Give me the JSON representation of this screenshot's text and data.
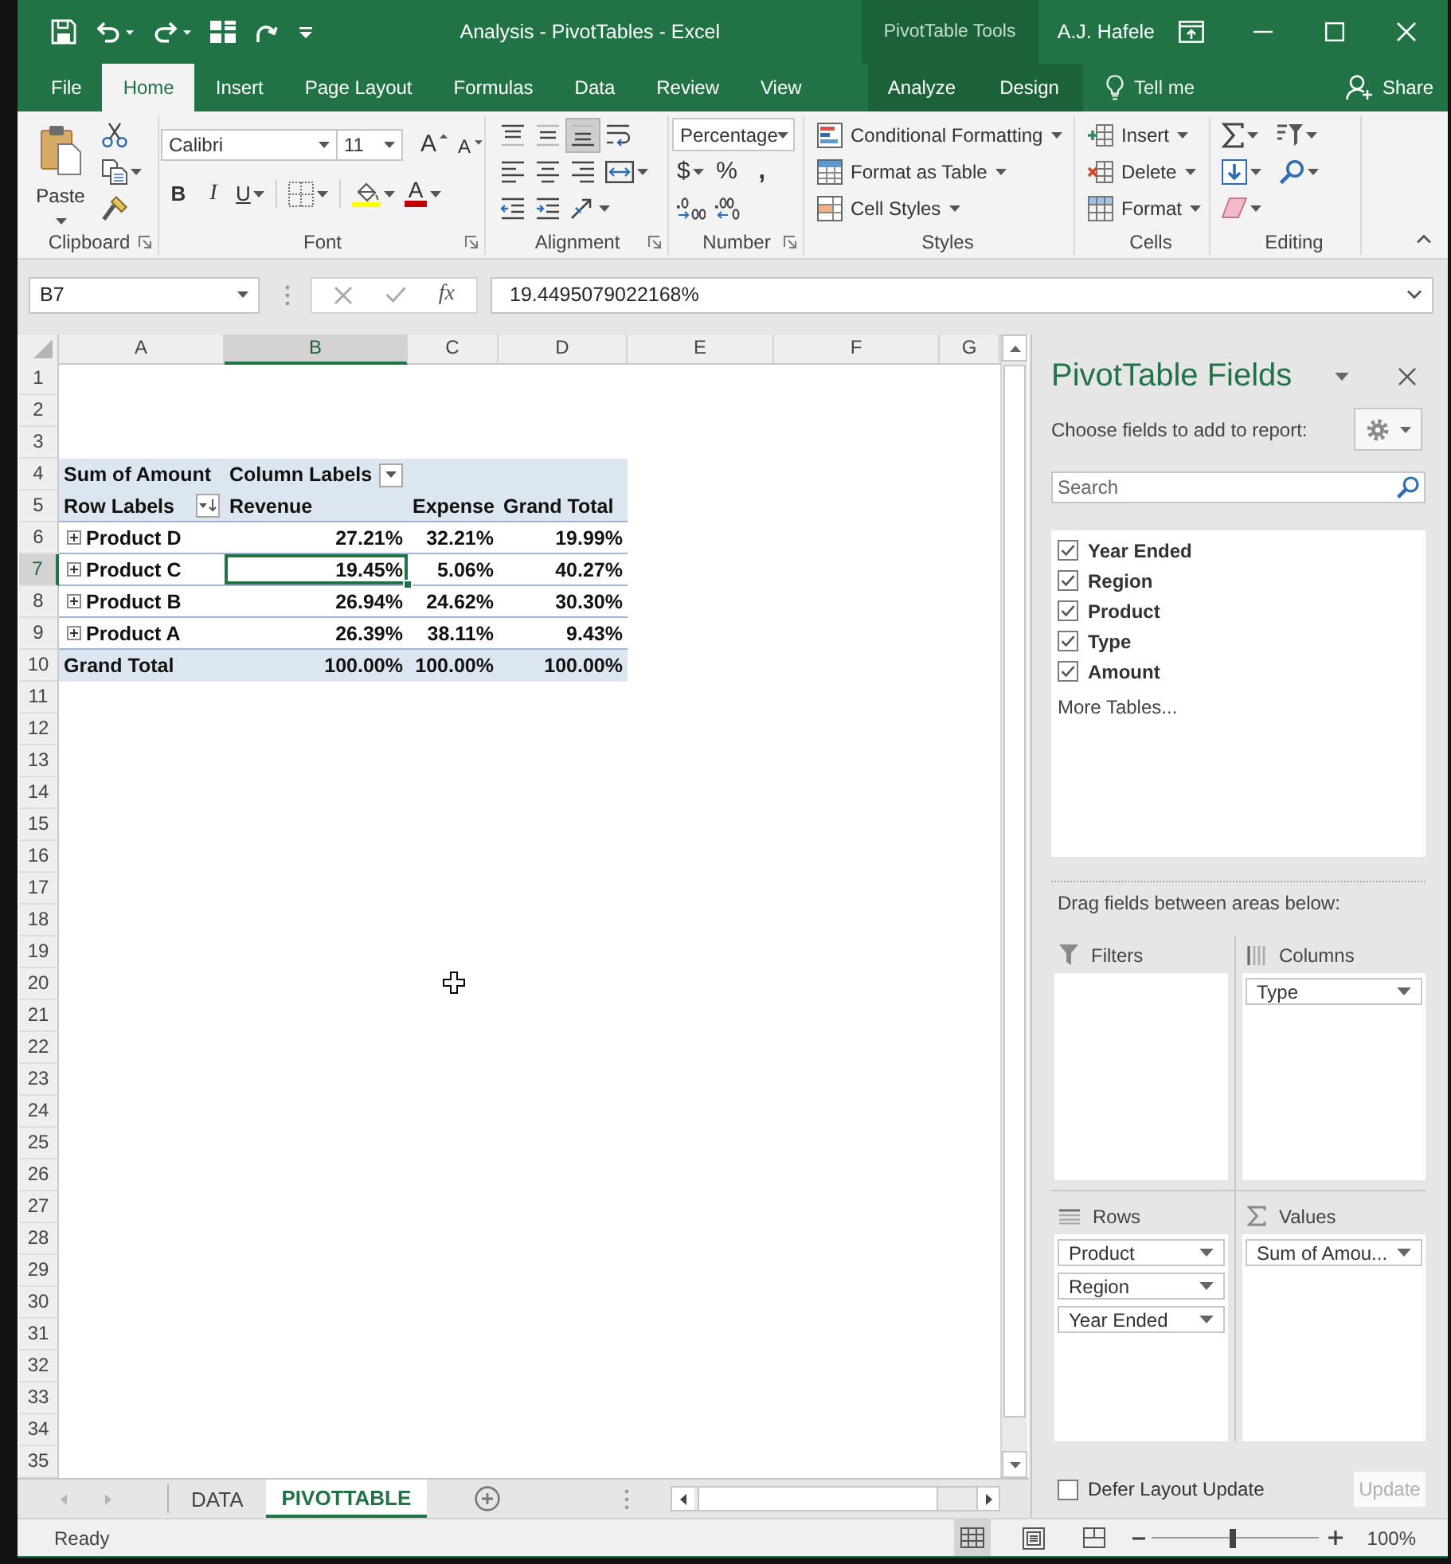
{
  "window": {
    "title": "Analysis - PivotTables - Excel",
    "context_title": "PivotTable Tools",
    "user": "A.J. Hafele"
  },
  "ribbon_tabs": [
    {
      "label": "File",
      "selected": false,
      "contextual": false
    },
    {
      "label": "Home",
      "selected": true,
      "contextual": false
    },
    {
      "label": "Insert",
      "selected": false,
      "contextual": false
    },
    {
      "label": "Page Layout",
      "selected": false,
      "contextual": false
    },
    {
      "label": "Formulas",
      "selected": false,
      "contextual": false
    },
    {
      "label": "Data",
      "selected": false,
      "contextual": false
    },
    {
      "label": "Review",
      "selected": false,
      "contextual": false
    },
    {
      "label": "View",
      "selected": false,
      "contextual": false
    },
    {
      "label": "Analyze",
      "selected": false,
      "contextual": true
    },
    {
      "label": "Design",
      "selected": false,
      "contextual": true
    }
  ],
  "tell_me": "Tell me",
  "share": "Share",
  "ribbon_groups": [
    {
      "label": "Clipboard",
      "launcher": true,
      "big": {
        "kind": "paste",
        "label": "Paste"
      },
      "rows": [
        {
          "items": [
            {
              "kind": "cut"
            }
          ]
        },
        {
          "items": [
            {
              "kind": "copy"
            }
          ]
        },
        {
          "items": [
            {
              "kind": "format-painter"
            }
          ]
        }
      ]
    },
    {
      "label": "Font",
      "launcher": true,
      "rows": [
        {
          "items": [
            {
              "kind": "font-name",
              "value": "Calibri"
            },
            {
              "kind": "font-size",
              "value": "11"
            },
            {
              "kind": "grow-font",
              "label": "A"
            },
            {
              "kind": "shrink-font",
              "label": "A"
            }
          ]
        },
        {
          "items": [
            {
              "kind": "bold",
              "label": "B",
              "on": false
            },
            {
              "kind": "italic",
              "label": "I",
              "on": false
            },
            {
              "kind": "underline",
              "label": "U",
              "on": false
            },
            {
              "kind": "borders"
            },
            {
              "kind": "fill-color"
            },
            {
              "kind": "font-color",
              "label": "A"
            }
          ]
        }
      ]
    },
    {
      "label": "Alignment",
      "launcher": true,
      "rows": [
        {
          "items": [
            {
              "kind": "align-top",
              "on": false
            },
            {
              "kind": "align-middle",
              "on": false
            },
            {
              "kind": "align-bottom",
              "on": true
            },
            {
              "kind": "wrap-text",
              "on": false
            }
          ]
        },
        {
          "items": [
            {
              "kind": "align-left",
              "on": false
            },
            {
              "kind": "align-center",
              "on": false
            },
            {
              "kind": "align-right",
              "on": false
            },
            {
              "kind": "merge",
              "on": false
            }
          ]
        },
        {
          "items": [
            {
              "kind": "outdent"
            },
            {
              "kind": "indent"
            },
            {
              "kind": "orientation"
            }
          ]
        }
      ]
    },
    {
      "label": "Number",
      "launcher": true,
      "rows": [
        {
          "items": [
            {
              "kind": "number-format",
              "value": "Percentage"
            }
          ]
        },
        {
          "items": [
            {
              "kind": "currency",
              "label": "$"
            },
            {
              "kind": "percent",
              "label": "%"
            },
            {
              "kind": "comma",
              "label": ","
            }
          ]
        },
        {
          "items": [
            {
              "kind": "increase-decimal"
            },
            {
              "kind": "decrease-decimal"
            }
          ]
        }
      ]
    },
    {
      "label": "Styles",
      "launcher": false,
      "rows": [
        {
          "items": [
            {
              "kind": "conditional-formatting",
              "label": "Conditional Formatting"
            }
          ]
        },
        {
          "items": [
            {
              "kind": "format-as-table",
              "label": "Format as Table"
            }
          ]
        },
        {
          "items": [
            {
              "kind": "cell-styles",
              "label": "Cell Styles"
            }
          ]
        }
      ]
    },
    {
      "label": "Cells",
      "launcher": false,
      "rows": [
        {
          "items": [
            {
              "kind": "insert-cells",
              "label": "Insert"
            }
          ]
        },
        {
          "items": [
            {
              "kind": "delete-cells",
              "label": "Delete"
            }
          ]
        },
        {
          "items": [
            {
              "kind": "format-cells",
              "label": "Format"
            }
          ]
        }
      ]
    },
    {
      "label": "Editing",
      "launcher": false,
      "rows": [
        {
          "items": [
            {
              "kind": "autosum"
            },
            {
              "kind": "sort-filter"
            }
          ]
        },
        {
          "items": [
            {
              "kind": "fill"
            },
            {
              "kind": "find"
            }
          ]
        },
        {
          "items": [
            {
              "kind": "clear"
            }
          ]
        }
      ]
    }
  ],
  "formula_bar": {
    "name_box": "B7",
    "function_label": "fx",
    "formula": "19.4495079022168%"
  },
  "sheet": {
    "columns": [
      {
        "label": "A",
        "selected": false
      },
      {
        "label": "B",
        "selected": true
      },
      {
        "label": "C",
        "selected": false
      },
      {
        "label": "D",
        "selected": false
      },
      {
        "label": "E",
        "selected": false
      },
      {
        "label": "F",
        "selected": false
      },
      {
        "label": "G",
        "selected": false
      }
    ],
    "rows": [
      {
        "label": "1",
        "selected": false
      },
      {
        "label": "2",
        "selected": false
      },
      {
        "label": "3",
        "selected": false
      },
      {
        "label": "4",
        "selected": false,
        "kind": "pivot-header",
        "cells": [
          {
            "kind": "label",
            "text": "Sum of Amount",
            "selected": false
          },
          {
            "kind": "filter",
            "text": "Column Labels",
            "selected": false
          }
        ]
      },
      {
        "label": "5",
        "selected": false,
        "kind": "pivot-header",
        "cells": [
          {
            "kind": "sort-filter",
            "text": "Row Labels",
            "selected": false
          },
          {
            "kind": "label",
            "text": "Revenue",
            "selected": false
          },
          {
            "kind": "label",
            "text": "Expense",
            "selected": false
          },
          {
            "kind": "label",
            "text": "Grand Total",
            "selected": false
          }
        ]
      },
      {
        "label": "6",
        "selected": false,
        "kind": "pivot-item",
        "cells": [
          {
            "kind": "item",
            "text": "Product D",
            "selected": false,
            "expanded": false
          },
          {
            "kind": "number",
            "text": "27.21%",
            "selected": false
          },
          {
            "kind": "number",
            "text": "32.21%",
            "selected": false
          },
          {
            "kind": "number",
            "text": "19.99%",
            "selected": false
          }
        ]
      },
      {
        "label": "7",
        "selected": true,
        "kind": "pivot-item",
        "cells": [
          {
            "kind": "item",
            "text": "Product C",
            "selected": false,
            "expanded": false
          },
          {
            "kind": "number",
            "text": "19.45%",
            "selected": true
          },
          {
            "kind": "number",
            "text": "5.06%",
            "selected": false
          },
          {
            "kind": "number",
            "text": "40.27%",
            "selected": false
          }
        ]
      },
      {
        "label": "8",
        "selected": false,
        "kind": "pivot-item",
        "cells": [
          {
            "kind": "item",
            "text": "Product B",
            "selected": false,
            "expanded": false
          },
          {
            "kind": "number",
            "text": "26.94%",
            "selected": false
          },
          {
            "kind": "number",
            "text": "24.62%",
            "selected": false
          },
          {
            "kind": "number",
            "text": "30.30%",
            "selected": false
          }
        ]
      },
      {
        "label": "9",
        "selected": false,
        "kind": "pivot-item",
        "cells": [
          {
            "kind": "item",
            "text": "Product A",
            "selected": false,
            "expanded": false
          },
          {
            "kind": "number",
            "text": "26.39%",
            "selected": false
          },
          {
            "kind": "number",
            "text": "38.11%",
            "selected": false
          },
          {
            "kind": "number",
            "text": "9.43%",
            "selected": false
          }
        ]
      },
      {
        "label": "10",
        "selected": false,
        "kind": "pivot-total",
        "cells": [
          {
            "kind": "label",
            "text": "Grand Total",
            "selected": false
          },
          {
            "kind": "number",
            "text": "100.00%",
            "selected": false
          },
          {
            "kind": "number",
            "text": "100.00%",
            "selected": false
          },
          {
            "kind": "number",
            "text": "100.00%",
            "selected": false
          }
        ]
      },
      {
        "label": "11",
        "selected": false
      },
      {
        "label": "12",
        "selected": false
      },
      {
        "label": "13",
        "selected": false
      },
      {
        "label": "14",
        "selected": false
      },
      {
        "label": "15",
        "selected": false
      },
      {
        "label": "16",
        "selected": false
      },
      {
        "label": "17",
        "selected": false
      },
      {
        "label": "18",
        "selected": false
      },
      {
        "label": "19",
        "selected": false
      },
      {
        "label": "20",
        "selected": false
      },
      {
        "label": "21",
        "selected": false
      },
      {
        "label": "22",
        "selected": false
      },
      {
        "label": "23",
        "selected": false
      },
      {
        "label": "24",
        "selected": false
      },
      {
        "label": "25",
        "selected": false
      },
      {
        "label": "26",
        "selected": false
      },
      {
        "label": "27",
        "selected": false
      },
      {
        "label": "28",
        "selected": false
      },
      {
        "label": "29",
        "selected": false
      },
      {
        "label": "30",
        "selected": false
      },
      {
        "label": "31",
        "selected": false
      },
      {
        "label": "32",
        "selected": false
      },
      {
        "label": "33",
        "selected": false
      },
      {
        "label": "34",
        "selected": false
      },
      {
        "label": "35",
        "selected": false
      }
    ]
  },
  "sheet_tabs": [
    {
      "label": "DATA",
      "selected": false
    },
    {
      "label": "PIVOTTABLE",
      "selected": true
    }
  ],
  "pivot_pane": {
    "title": "PivotTable Fields",
    "subtitle": "Choose fields to add to report:",
    "search": {
      "placeholder": "Search"
    },
    "fields": [
      {
        "label": "Year Ended",
        "checked": true
      },
      {
        "label": "Region",
        "checked": true
      },
      {
        "label": "Product",
        "checked": true
      },
      {
        "label": "Type",
        "checked": true
      },
      {
        "label": "Amount",
        "checked": true
      }
    ],
    "more_link": "More Tables...",
    "areas_hint": "Drag fields between areas below:",
    "areas": [
      {
        "kind": "filters",
        "label": "Filters"
      },
      {
        "kind": "columns",
        "label": "Columns",
        "items": [
          {
            "label": "Type"
          }
        ]
      },
      {
        "kind": "rows",
        "label": "Rows",
        "items": [
          {
            "label": "Product"
          },
          {
            "label": "Region"
          },
          {
            "label": "Year Ended"
          }
        ]
      },
      {
        "kind": "values",
        "label": "Values",
        "items": [
          {
            "label": "Sum of Amou..."
          }
        ]
      }
    ],
    "defer_update": {
      "label": "Defer Layout Update",
      "checked": false
    },
    "update_button": {
      "label": "Update",
      "disabled": true
    }
  },
  "status_bar": {
    "text": "Ready",
    "views": [
      {
        "kind": "normal",
        "selected": true
      },
      {
        "kind": "page-layout",
        "selected": false
      },
      {
        "kind": "page-break",
        "selected": false
      }
    ],
    "zoom": {
      "level": 0.48,
      "reading": "100%"
    }
  }
}
